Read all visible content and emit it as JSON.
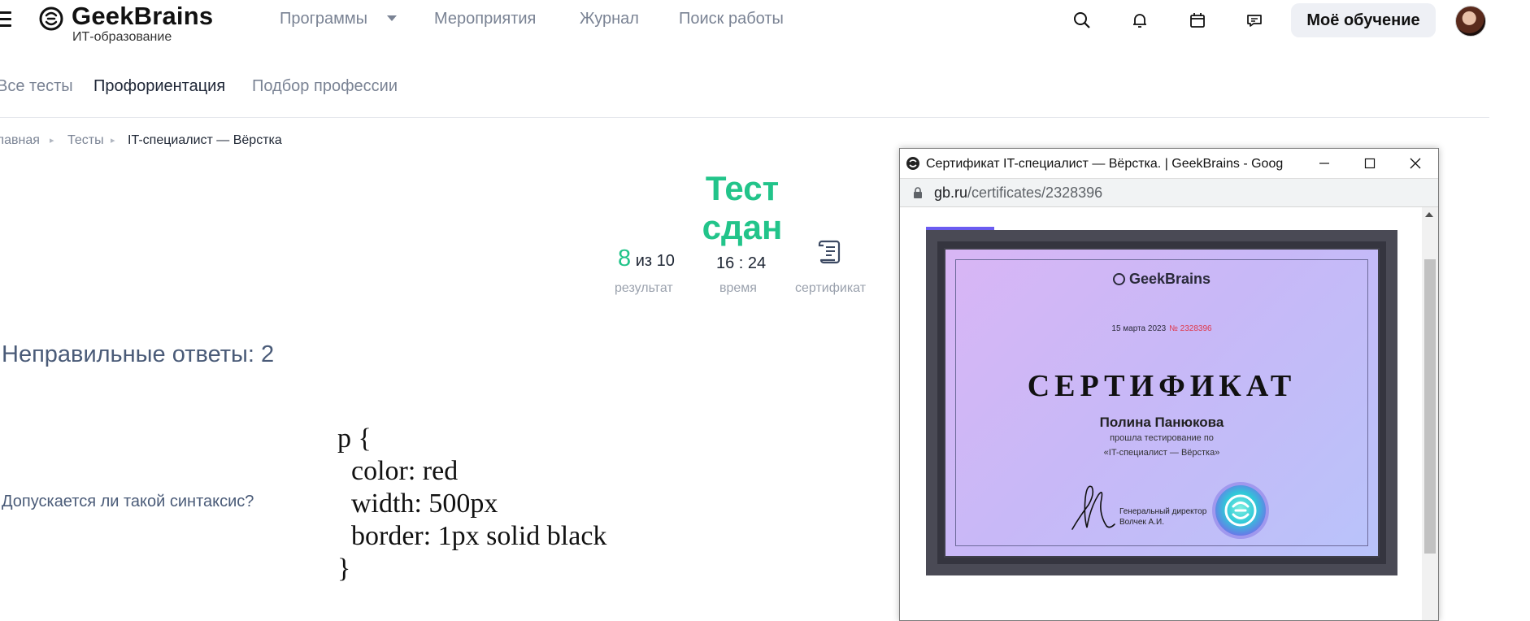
{
  "header": {
    "logo_name": "GeekBrains",
    "logo_sub": "ИТ-образование",
    "nav": [
      "Программы",
      "Мероприятия",
      "Журнал",
      "Поиск работы"
    ],
    "icons": [
      "search-icon",
      "bell-icon",
      "calendar-icon",
      "chat-icon"
    ],
    "learning_button": "Моё обучение"
  },
  "subnav": {
    "tabs": [
      "Все тесты",
      "Профориентация",
      "Подбор профессии"
    ],
    "active": "Профориентация"
  },
  "breadcrumb": [
    "Главная",
    "Тесты",
    "IT-специалист — Вёрстка"
  ],
  "result": {
    "title": "Тест сдан",
    "score": "8",
    "score_total": "из 10",
    "score_caption": "результат",
    "time": "16 : 24",
    "time_caption": "время",
    "certificate_caption": "сертификат"
  },
  "wrong_answers": "Неправильные ответы: 2",
  "question": {
    "text": "Допускается ли такой синтаксис?",
    "code": [
      "p {",
      "  color: red",
      "  width: 500px",
      "  border: 1px solid black",
      "}"
    ]
  },
  "popup": {
    "window_title": "Сертификат IT-специалист — Вёрстка. | GeekBrains - Google Chro...",
    "url_host": "gb.ru",
    "url_path": "/certificates/2328396",
    "accent_color": "#6b5cf0",
    "certificate": {
      "brand": "GeekBrains",
      "date": "15 марта 2023",
      "number": "№ 2328396",
      "heading": "СЕРТИФИКАТ",
      "name": "Полина Панюкова",
      "line1": "прошла тестирование по",
      "line2": "«IT-специалист — Вёрстка»",
      "role": "Генеральный директор",
      "signer": "Волчек А.И."
    }
  },
  "colors": {
    "success": "#22c48a",
    "muted": "#7a8394",
    "accent": "#6b5cf0"
  }
}
